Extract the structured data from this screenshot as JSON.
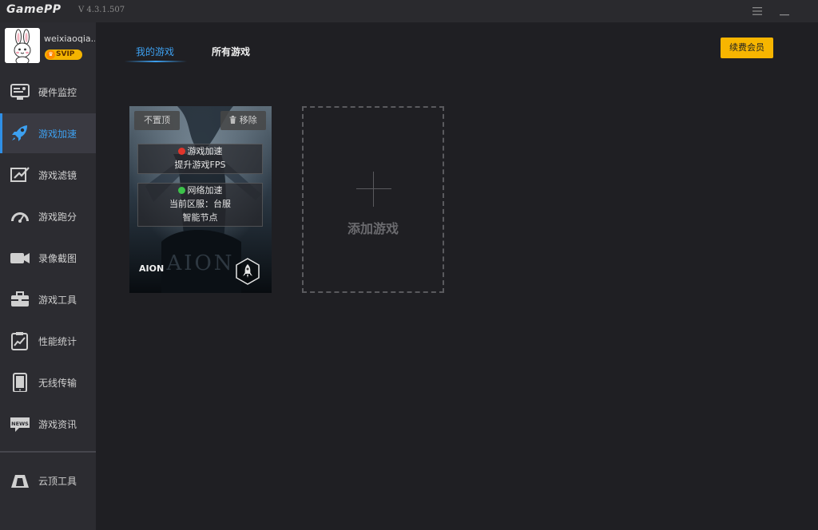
{
  "app": {
    "logo_game": "Game",
    "logo_pp": "PP",
    "version": "V 4.3.1.507"
  },
  "window_controls": {
    "menu_icon": "menu-icon",
    "minimize_icon": "minimize-icon"
  },
  "profile": {
    "username": "weixiaoqia..",
    "badge": "SVIP"
  },
  "sidebar": {
    "items": [
      {
        "label": "硬件监控",
        "icon": "hardware-monitor-icon"
      },
      {
        "label": "游戏加速",
        "icon": "rocket-icon",
        "active": true
      },
      {
        "label": "游戏滤镜",
        "icon": "filter-icon"
      },
      {
        "label": "游戏跑分",
        "icon": "speedometer-icon"
      },
      {
        "label": "录像截图",
        "icon": "video-camera-icon"
      },
      {
        "label": "游戏工具",
        "icon": "toolbox-icon"
      },
      {
        "label": "性能统计",
        "icon": "stats-chart-icon"
      },
      {
        "label": "无线传输",
        "icon": "tablet-icon"
      },
      {
        "label": "游戏资讯",
        "icon": "news-icon"
      }
    ],
    "bottom_item": {
      "label": "云顶工具",
      "icon": "cloud-top-tool-icon"
    }
  },
  "tabs": {
    "mine": "我的游戏",
    "all": "所有游戏"
  },
  "renew_button": "续费会员",
  "game_card": {
    "pin_label": "不置顶",
    "remove_label": "移除",
    "accel_title": "游戏加速",
    "accel_sub": "提升游戏FPS",
    "net_title": "网络加速",
    "net_region": "当前区服：台服",
    "net_node": "智能节点",
    "game_name": "AION",
    "colors": {
      "accel_dot": "#e0352b",
      "net_dot": "#3cc24a"
    }
  },
  "add_card": {
    "label": "添加游戏"
  },
  "colors": {
    "accent_blue": "#3da0f0",
    "renew_yellow": "#f7b500",
    "background": "#1f1f23",
    "sidebar": "#2c2c31"
  }
}
